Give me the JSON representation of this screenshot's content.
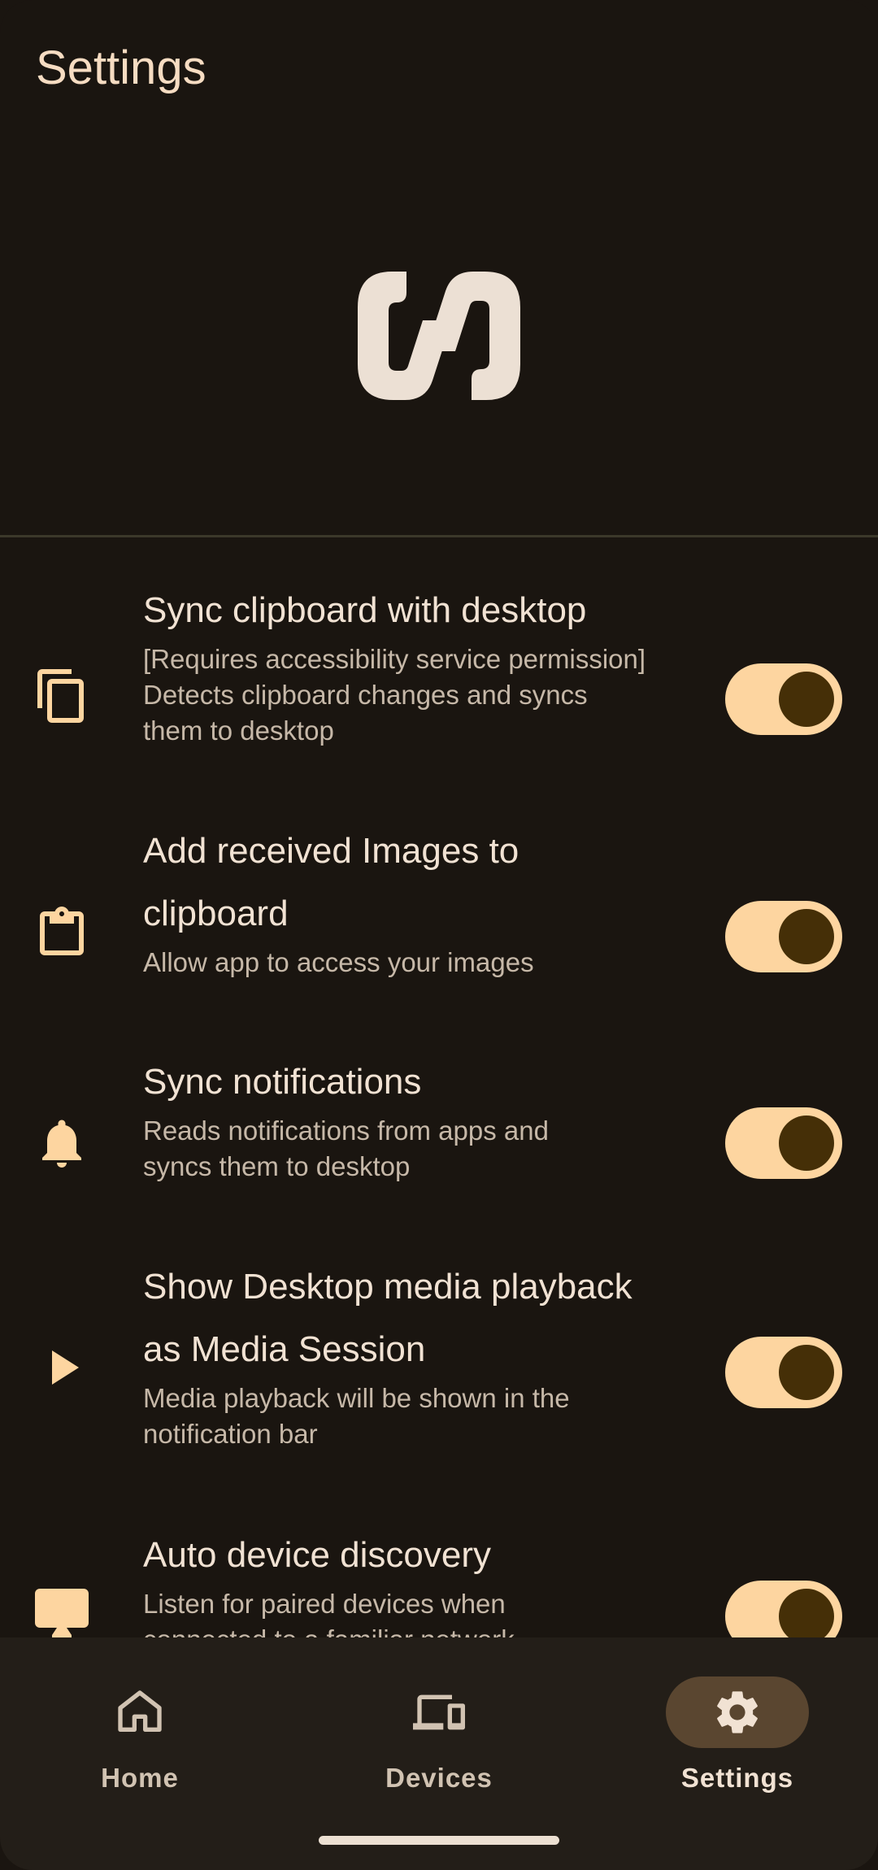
{
  "header": {
    "title": "Settings"
  },
  "settings": [
    {
      "title": "Sync clipboard with desktop",
      "description": "[Requires accessibility service permission] Detects clipboard changes and syncs them to desktop",
      "icon": "copy-icon",
      "enabled": true
    },
    {
      "title": "Add received Images to clipboard",
      "description": "Allow app to access your images",
      "icon": "clipboard-icon",
      "enabled": true
    },
    {
      "title": "Sync notifications",
      "description": "Reads notifications from apps and syncs them to desktop",
      "icon": "bell-icon",
      "enabled": true
    },
    {
      "title": "Show Desktop media playback as Media Session",
      "description": "Media playback will be shown in the notification bar",
      "icon": "play-icon",
      "enabled": true
    },
    {
      "title": "Auto device discovery",
      "description": "Listen for paired devices when connected to a familiar network",
      "icon": "monitor-icon",
      "enabled": true
    }
  ],
  "nav": {
    "items": [
      {
        "label": "Home",
        "icon": "home-icon",
        "active": false
      },
      {
        "label": "Devices",
        "icon": "devices-icon",
        "active": false
      },
      {
        "label": "Settings",
        "icon": "gear-icon",
        "active": true
      }
    ]
  },
  "colors": {
    "background": "#1a1510",
    "accent": "#fdd5a0",
    "switch_knob": "#452f07",
    "nav_background": "#231e18",
    "nav_active_pill": "#5a4630"
  }
}
